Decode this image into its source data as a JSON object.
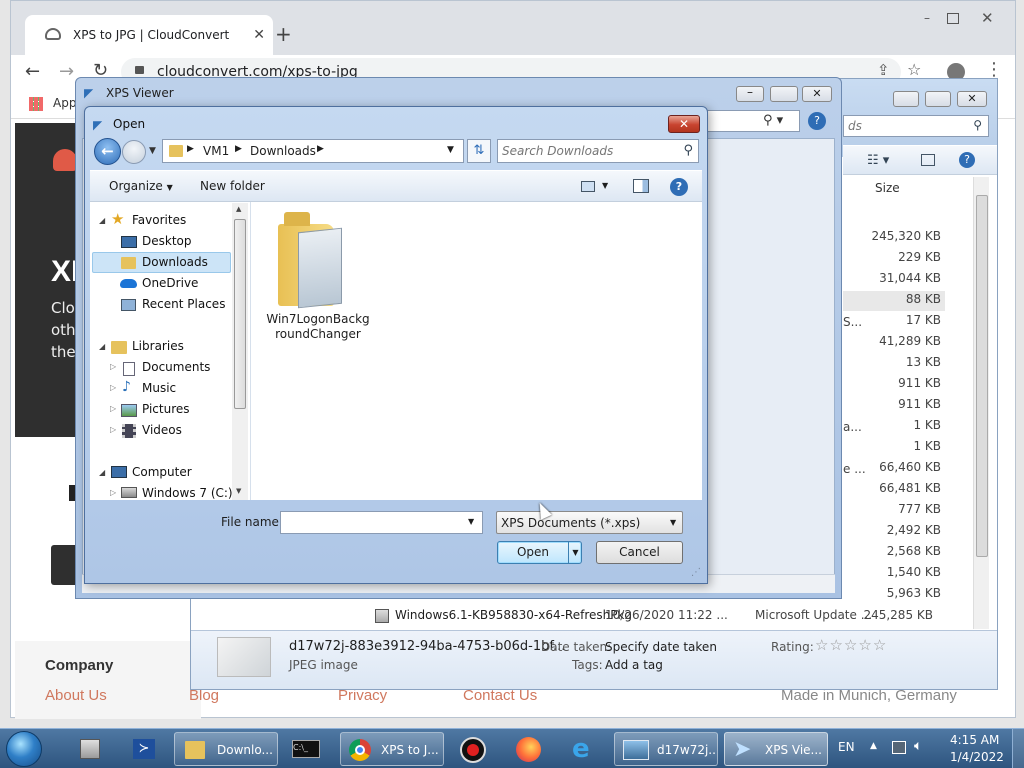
{
  "browser": {
    "tab_title": "XPS to JPG | CloudConvert",
    "url": "cloudconvert.com/xps-to-jpg",
    "bookmarks_label": "Apps"
  },
  "website": {
    "hero_fragment": "XI",
    "desc_lines": [
      "Clou",
      "othe",
      "the"
    ],
    "footer_heading": "Company",
    "footer_links": [
      "About Us",
      "Blog",
      "Privacy",
      "Contact Us"
    ],
    "made_in": "Made in Munich, Germany"
  },
  "explorer": {
    "search_placeholder": "ds",
    "size_header": "Size",
    "sizes": [
      "245,320 KB",
      "229 KB",
      "31,044 KB",
      "88 KB",
      "17 KB",
      "41,289 KB",
      "13 KB",
      "911 KB",
      "911 KB",
      "1 KB",
      "1 KB",
      "66,460 KB",
      "66,481 KB",
      "777 KB",
      "2,492 KB",
      "2,568 KB",
      "1,540 KB",
      "5,963 KB",
      "245,285 KB"
    ],
    "partial_fragments": [
      "S...",
      "a...",
      "e ..."
    ],
    "last_row": {
      "name": "Windows6.1-KB958830-x64-RefreshPkg",
      "date": "10/26/2020 11:22 ...",
      "type": "Microsoft Update ..."
    },
    "details": {
      "filename": "d17w72j-883e3912-94ba-4753-b06d-1bf...",
      "filetype": "JPEG image",
      "date_taken_label": "Date taken:",
      "date_taken_value": "Specify date taken",
      "tags_label": "Tags:",
      "tags_value": "Add a tag",
      "rating_label": "Rating:",
      "rating": 0,
      "rating_max": 5
    }
  },
  "xps_viewer": {
    "title": "XPS Viewer"
  },
  "open_dialog": {
    "title": "Open",
    "breadcrumb": [
      "VM1",
      "Downloads"
    ],
    "search_placeholder": "Search Downloads",
    "organize_label": "Organize",
    "new_folder_label": "New folder",
    "nav": {
      "favorites": "Favorites",
      "fav_items": [
        "Desktop",
        "Downloads",
        "OneDrive",
        "Recent Places"
      ],
      "libraries": "Libraries",
      "lib_items": [
        "Documents",
        "Music",
        "Pictures",
        "Videos"
      ],
      "computer": "Computer",
      "drive": "Windows 7 (C:)"
    },
    "content_items": [
      {
        "name_line1": "Win7LogonBackg",
        "name_line2": "roundChanger"
      }
    ],
    "file_name_label": "File name:",
    "file_name_value": "",
    "file_type": "XPS Documents (*.xps)",
    "open_label": "Open",
    "cancel_label": "Cancel"
  },
  "taskbar": {
    "buttons": [
      "Downlo...",
      "XPS to J...",
      "d17w72j...",
      "XPS Vie..."
    ],
    "language": "EN",
    "time": "4:15 AM",
    "date": "1/4/2022"
  },
  "colors": {
    "accent": "#3c7fb1",
    "footer_link": "#d0785e",
    "taskbar": "#2e557f"
  }
}
